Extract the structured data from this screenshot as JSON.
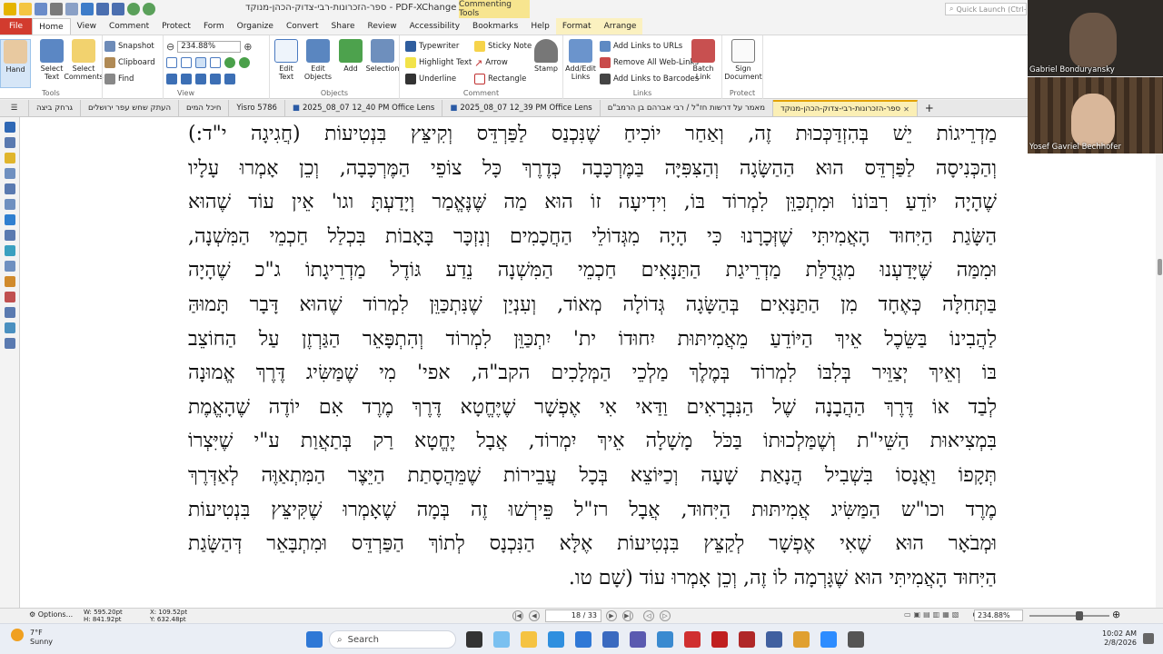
{
  "app": {
    "title": "ספר-הזכרונות-רבי-צדוק-הכהן-מנוקד - PDF-XChange Editor",
    "context_tools": "Commenting Tools",
    "quick_launch_placeholder": "Quick Launch (Ctrl+.)"
  },
  "menus": [
    "File",
    "Home",
    "View",
    "Comment",
    "Protect",
    "Form",
    "Organize",
    "Convert",
    "Share",
    "Review",
    "Accessibility",
    "Bookmarks",
    "Help",
    "Format",
    "Arrange"
  ],
  "ribbon": {
    "hand": "Hand",
    "select_text": [
      "Select",
      "Text"
    ],
    "select_comments": [
      "Select",
      "Comments"
    ],
    "tools_group": "Tools",
    "zoom_value": "234.88%",
    "snapshot": "Snapshot",
    "clipboard": "Clipboard",
    "find": "Find",
    "view_group": "View",
    "edit_text": [
      "Edit",
      "Text"
    ],
    "edit_objects": [
      "Edit",
      "Objects"
    ],
    "add": "Add",
    "selection": "Selection",
    "objects_group": "Objects",
    "typewriter": "Typewriter",
    "highlight_text": "Highlight Text",
    "underline": "Underline",
    "sticky_note": "Sticky Note",
    "arrow": "Arrow",
    "rectangle": "Rectangle",
    "stamp": "Stamp",
    "comment_group": "Comment",
    "add_edit_links": [
      "Add/Edit",
      "Links"
    ],
    "add_links_urls": "Add Links to URLs",
    "remove_web_links": "Remove All Web-Links",
    "add_links_barcodes": "Add Links to Barcodes",
    "batch_link": [
      "Batch",
      "Link"
    ],
    "links_group": "Links",
    "sign_document": [
      "Sign",
      "Document"
    ],
    "protect_group": "Protect"
  },
  "tabs": [
    {
      "label": "גרחק ביצה",
      "active": false
    },
    {
      "label": "העתק שחש עפר ירושלים",
      "active": false
    },
    {
      "label": "חיכל המים",
      "active": false
    },
    {
      "label": "Yisro 5786",
      "active": false
    },
    {
      "label": "2025_08_07 12_40 PM Office Lens",
      "active": false
    },
    {
      "label": "2025_08_07 12_39 PM Office Lens",
      "active": false
    },
    {
      "label": "מאמר על דרשות חז\"ל / רבי אברהם בן הרמב\"ם",
      "active": false
    },
    {
      "label": "ספר-הזכרונות-רבי-צדוק-הכהן-מנוקד",
      "active": true
    }
  ],
  "document": {
    "lines": [
      "מַדְרֵיגוֹת יֵשׁ בְּהִזְדַּכְּכוּת זֶה, וְאַחַר יוֹכִיחַ שֶׁנִּכְנַס לַפַּרְדֵּס וְקִיצֵּץ בִּנְטִיעוֹת (חֲגִיגָה י\"ד:)",
      "וְהַכְּנִיסָה לַפַּרְדֵּס הוּא הַהַשָּׂגָה וְהַצִּפִּיָּה בַּמֶּרְכָּבָה כְּדֶרֶךְ כָּל צוֹפֵי הַמֶּרְכָּבָה, וְכֵן אָמְרוּ עָלָיו",
      "שֶׁהָיָה יוֹדֵעַ רִבּוֹנוֹ וּמִתְכַּוֵּן לִמְרוֹד בּוֹ, וִידִיעָה זוֹ הוּא מַה שֶּׁנֶּאֱמַר וְיָדַעְתָּ וגו' אֵין עוֹד שֶׁהוּא",
      "הַשָּׂגַת הַיִּחוּד הָאֲמִיתִּי שֶׁזְּכָרָנוּ כִּי הָיָה מִגְּדוֹלֵי הַחֲכָמִים וְנִזְכָּר בָּאָבוֹת בִּכְלַל חַכְמֵי הַמִּשְׁנָה,",
      "וּמִמַּה שֶּׁיָּדַעְנוּ מִגְּדֻלַּת מַדְרֵיגַת הַתַּנָּאִים חַכְמֵי הַמִּשְׁנָה נֵדַע גּוֹדֶל מַדְרֵיגָתוֹ ג\"כ שֶׁהָיָה",
      "בַּתְּחִלָּה כְּאֶחָד מִן הַתַּנָּאִים בְּהַשָּׂגָה גְּדוֹלָה מְאוֹד, וְעִנְיַן שֶׁנִּתְכַּוֵּן לִמְרוֹד שֶׁהוּא דָּבָר תָּמוּהַּ",
      "לַהֲבִינוֹ בַּשֵּׂכֶל אֵיךְ הַיּוֹדֵעַ מֵאֲמִיתּוּת יִחוּדוֹ ית' יִתְכַּוֵּן לִמְרוֹד וְהִתְפָּאֵר הַגַּרְזֶן עַל הַחוֹצֵב",
      "בּוֹ וְאֵיךְ יְצַוֵּיר בְּלִבּוֹ לִמְרוֹד בְּמֶלֶךְ מַלְכֵי הַמְּלָכִים הקב\"ה, אפי' מִי שֶׁמַּשִּׂיג דֶּרֶךְ אֱמוּנָה",
      "לְבַד אוֹ דֶּרֶךְ הַהֲבָנָה שֶׁל הַנִּבְרָאִים וַדַּאי אִי אֶפְשָׁר שֶׁיֶּחֱטָא דֶּרֶךְ מֶרֶד אִם יוֹדֶה שֶׁהָאֱמֶת",
      "בִּמְצִיאוּת הַשֵּׁי\"ת וְשֶׁמַּלְכוּתוֹ בַּכֹּל מָשָׁלָה אֵיךְ יִמְרוֹד, אֲבָל יֶחֱטָא רַק בְּתַאֲוַת ע\"י שֶׁיִּצְרוֹ",
      "תְּקָפוֹ וַאֲנָסוֹ בִּשְׁבִיל הֲנָאַת שָׁעָה וְכַיּוֹצֵא בְּכָל עֲבֵירוֹת שֶׁמֵּהֲסָתַת הַיֵּצֶר הַמִּתְאַוֶּה לְאַדְּרֶךְ",
      "מֶרֶד וכו\"ש הַמַּשִּׂיג אֲמִיתּוּת הַיִּחוּד, אֲבָל רז\"ל פֵּירְשׁוּ זֶה בְּמָה שֶׁאָמְרוּ שֶׁקִּיצֵּץ בִּנְטִיעוֹת",
      "וּמְבֹאָר הוּא שֶׁאִי אֶפְשָׁר לְקַצֵּץ בִּנְטִיעוֹת אֶלָּא הַנִּכְנָס לְתוֹךְ הַפַּרְדֵּס וּמִתְבָּאֵר דְּהַשָּׂגַת",
      "הַיִּחוּד הָאֲמִיתִּי הוּא שֶׁגָּרְמָה לוֹ זֶה, וְכֵן אָמְרוּ עוֹד (שָׁם טו."
    ]
  },
  "status": {
    "options": "Options...",
    "width": "W: 595.20pt",
    "height": "H: 841.92pt",
    "x": "X: 109.52pt",
    "y": "Y: 632.48pt",
    "page": "18 / 33",
    "zoom": "234.88%"
  },
  "taskbar": {
    "weather_temp": "7°F",
    "weather_desc": "Sunny",
    "search": "Search",
    "time": "10:02 AM",
    "date": "2/8/2026"
  },
  "participants": [
    "Gabriel Bonduryansky",
    "Yosef Gavriel Bechhofer"
  ]
}
